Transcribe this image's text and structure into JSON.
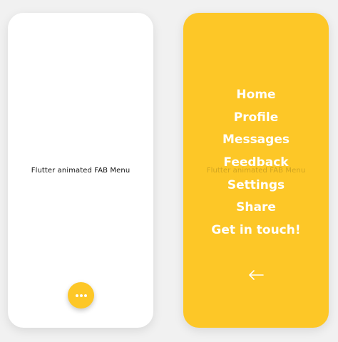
{
  "left_screen": {
    "title": "Flutter animated FAB Menu",
    "fab_icon": "more-horizontal-icon"
  },
  "right_screen": {
    "faded_title": "Flutter animated FAB Menu",
    "menu_items": [
      {
        "label": "Home"
      },
      {
        "label": "Profile"
      },
      {
        "label": "Messages"
      },
      {
        "label": "Feedback"
      },
      {
        "label": "Settings"
      },
      {
        "label": "Share"
      },
      {
        "label": "Get in touch!"
      }
    ],
    "back_icon": "arrow-left-icon"
  },
  "colors": {
    "accent": "#fdc727",
    "background": "#f1f1f1",
    "screen": "#ffffff",
    "menu_text": "#ffffff"
  }
}
